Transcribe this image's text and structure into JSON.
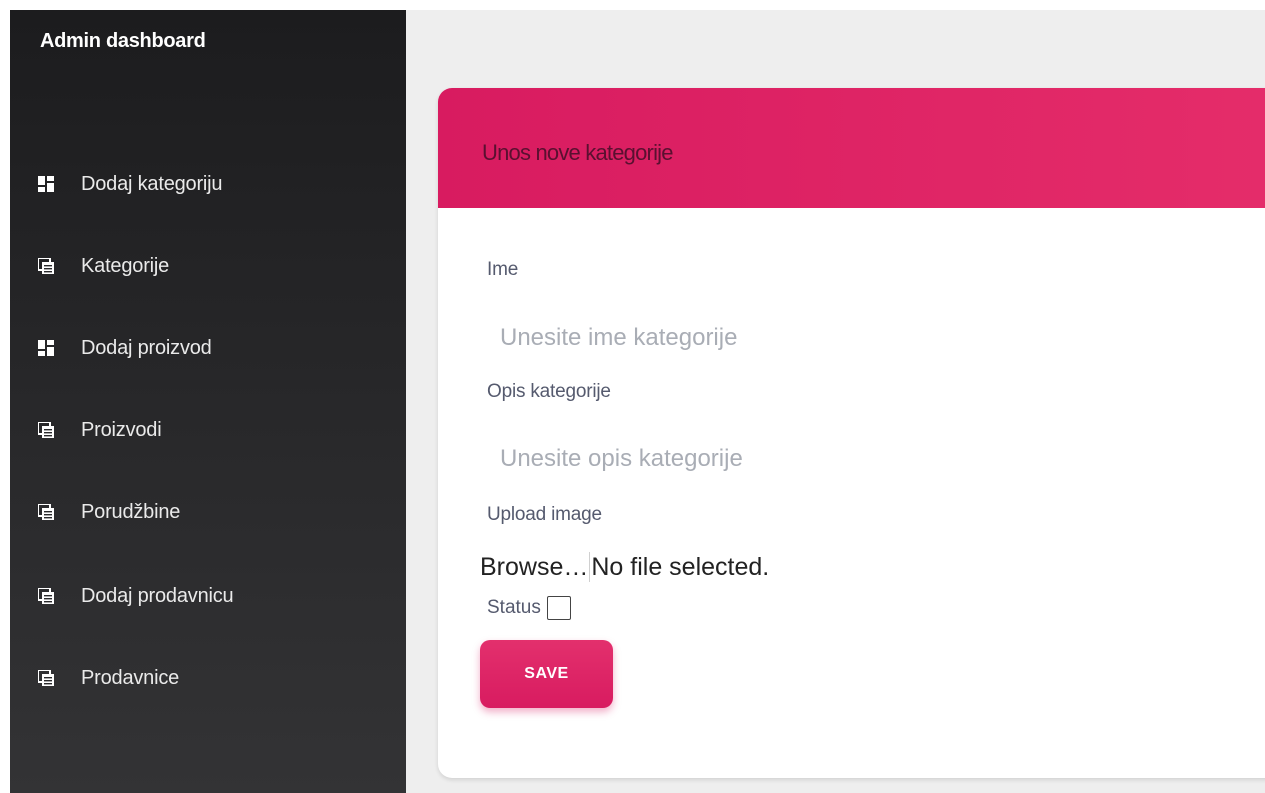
{
  "sidebar": {
    "title": "Admin dashboard",
    "items": [
      {
        "label": "Dodaj kategoriju",
        "icon": "dashboard-icon"
      },
      {
        "label": "Kategorije",
        "icon": "library-icon"
      },
      {
        "label": "Dodaj proizvod",
        "icon": "dashboard-icon"
      },
      {
        "label": "Proizvodi",
        "icon": "library-icon"
      },
      {
        "label": "Porudžbine",
        "icon": "library-icon"
      },
      {
        "label": "Dodaj prodavnicu",
        "icon": "library-icon"
      },
      {
        "label": "Prodavnice",
        "icon": "library-icon"
      }
    ]
  },
  "card": {
    "title": "Unos nove kategorije",
    "name_label": "Ime",
    "name_placeholder": "Unesite ime kategorije",
    "name_value": "",
    "desc_label": "Opis kategorije",
    "desc_placeholder": "Unesite opis kategorije",
    "desc_value": "",
    "upload_label": "Upload image",
    "browse_label": "Browse…",
    "file_status": "No file selected.",
    "status_label": "Status",
    "status_checked": false,
    "save_label": "SAVE"
  },
  "colors": {
    "accent": "#d81b60",
    "sidebar_bg": "#1c1c1e",
    "main_bg": "#eeeeee"
  }
}
